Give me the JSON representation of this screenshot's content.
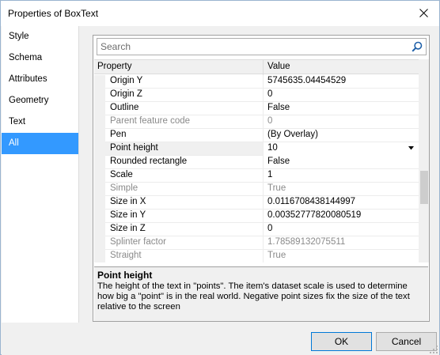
{
  "window": {
    "title": "Properties of BoxText"
  },
  "sidebar": {
    "items": [
      {
        "label": "Style"
      },
      {
        "label": "Schema"
      },
      {
        "label": "Attributes"
      },
      {
        "label": "Geometry"
      },
      {
        "label": "Text"
      },
      {
        "label": "All",
        "selected": true
      }
    ]
  },
  "search": {
    "placeholder": "Search"
  },
  "grid": {
    "columns": {
      "property": "Property",
      "value": "Value"
    },
    "rows": [
      {
        "name": "Origin Y",
        "value": "5745635.04454529",
        "readonly": false
      },
      {
        "name": "Origin Z",
        "value": "0",
        "readonly": false
      },
      {
        "name": "Outline",
        "value": "False",
        "readonly": false
      },
      {
        "name": "Parent feature code",
        "value": "0",
        "readonly": true
      },
      {
        "name": "Pen",
        "value": " (By Overlay)",
        "readonly": false
      },
      {
        "name": "Point height",
        "value": "10",
        "readonly": false,
        "selected": true
      },
      {
        "name": "Rounded rectangle",
        "value": "False",
        "readonly": false
      },
      {
        "name": "Scale",
        "value": "1",
        "readonly": false
      },
      {
        "name": "Simple",
        "value": "True",
        "readonly": true
      },
      {
        "name": "Size in X",
        "value": "0.0116708438144997",
        "readonly": false
      },
      {
        "name": "Size in Y",
        "value": "0.00352777820080519",
        "readonly": false
      },
      {
        "name": "Size in Z",
        "value": "0",
        "readonly": false
      },
      {
        "name": "Splinter factor",
        "value": "1.78589132075511",
        "readonly": true
      },
      {
        "name": "Straight",
        "value": "True",
        "readonly": true
      }
    ]
  },
  "description": {
    "title": "Point height",
    "text": "The height of the text in \"points\". The item's dataset scale is used to determine how big a \"point\" is in the real world. Negative point sizes fix the size of the text relative to the screen"
  },
  "buttons": {
    "ok": "OK",
    "cancel": "Cancel"
  },
  "colors": {
    "selection": "#3399ff",
    "readonly_text": "#8a8a8a",
    "panel_bg": "#f0f0f0"
  }
}
